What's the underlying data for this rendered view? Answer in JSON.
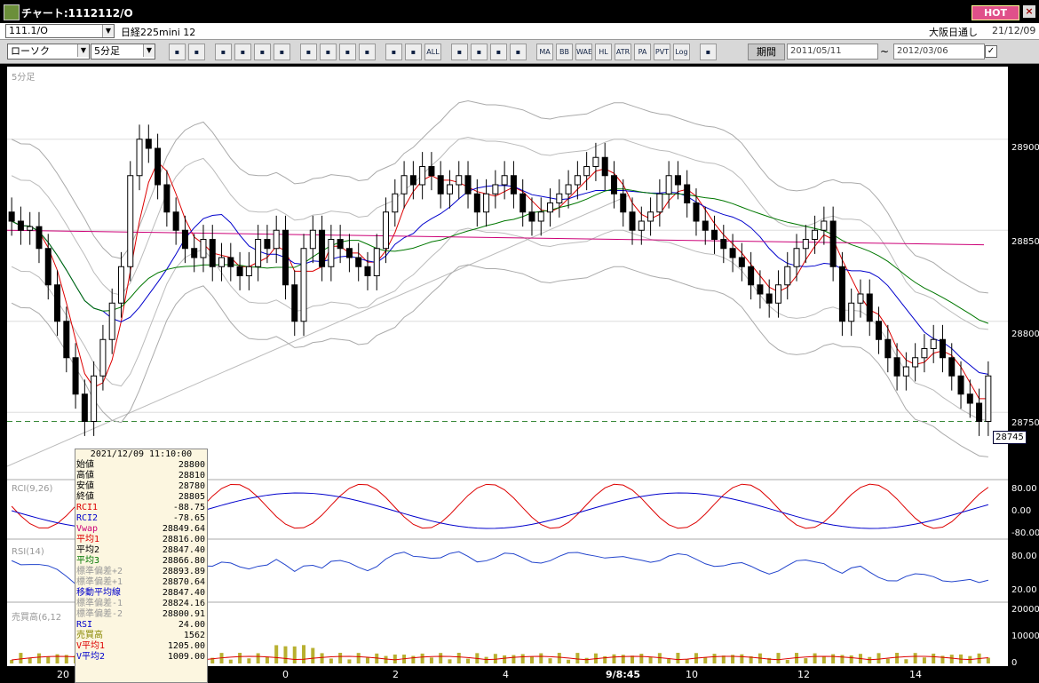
{
  "window": {
    "title": "チャート:1112112/O",
    "hot_label": "HOT",
    "close_glyph": "×"
  },
  "infobar": {
    "symbol": "111.1/O",
    "issue": "日経225mini 12",
    "market": "大阪日通し",
    "date": "21/12/09"
  },
  "toolbar": {
    "chart_type": "ローソク",
    "timeframe": "5分足",
    "period_button": "期間",
    "date_from": "2011/05/11",
    "date_to": "2012/03/06",
    "tilde": "~",
    "icons": [
      "search-icon",
      "crosshair-icon",
      "grid-icon",
      "zoom-icon",
      "indicator-icon",
      "bars-icon",
      "trend-icon",
      "pen-icon",
      "pointer-icon",
      "undo-icon",
      "compare-icon",
      "left-icon",
      "ALL",
      "settings-icon",
      "tool-icon",
      "color-icon",
      "ma-icon",
      "MA",
      "BB",
      "WAE",
      "HL",
      "ATR",
      "PA",
      "PVT",
      "Log",
      "export-icon"
    ]
  },
  "chart": {
    "timeframe_label": "5分足",
    "rci_label": "RCI(9,26)",
    "rsi_label": "RSI(14)",
    "volume_label": "売買高(6,12",
    "last_price": "28745",
    "price_axis": [
      "28900",
      "28850",
      "28800",
      "28750"
    ],
    "rci_axis": [
      "80.00",
      "0.00",
      "-80.00"
    ],
    "rsi_axis": [
      "80.00",
      "20.00"
    ],
    "vol_axis": [
      "20000",
      "10000",
      "0"
    ],
    "time_axis": [
      "20",
      "0",
      "2",
      "4",
      "9/8:45",
      "10",
      "12",
      "14"
    ]
  },
  "info_panel": {
    "datetime": "2021/12/09  11:10:00",
    "rows": [
      {
        "k": "始値",
        "v": "28800",
        "color": "#000000"
      },
      {
        "k": "高値",
        "v": "28810",
        "color": "#000000"
      },
      {
        "k": "安値",
        "v": "28780",
        "color": "#000000"
      },
      {
        "k": "終値",
        "v": "28805",
        "color": "#000000"
      },
      {
        "k": "RCI1",
        "v": "-88.75",
        "color": "#dd0000"
      },
      {
        "k": "RCI2",
        "v": "-78.65",
        "color": "#0000cc"
      },
      {
        "k": "Vwap",
        "v": "28849.64",
        "color": "#cc0077"
      },
      {
        "k": "平均1",
        "v": "28816.00",
        "color": "#dd0000"
      },
      {
        "k": "平均2",
        "v": "28847.40",
        "color": "#000000"
      },
      {
        "k": "平均3",
        "v": "28866.80",
        "color": "#007700"
      },
      {
        "k": "標準偏差+2",
        "v": "28893.89",
        "color": "#999999"
      },
      {
        "k": "標準偏差+1",
        "v": "28870.64",
        "color": "#999999"
      },
      {
        "k": "移動平均線",
        "v": "28847.40",
        "color": "#0000cc"
      },
      {
        "k": "標準偏差-1",
        "v": "28824.16",
        "color": "#999999"
      },
      {
        "k": "標準偏差-2",
        "v": "28800.91",
        "color": "#999999"
      },
      {
        "k": "RSI",
        "v": "24.00",
        "color": "#0000cc"
      },
      {
        "k": "売買高",
        "v": "1562",
        "color": "#888800"
      },
      {
        "k": "V平均1",
        "v": "1205.00",
        "color": "#dd0000"
      },
      {
        "k": "V平均2",
        "v": "1009.00",
        "color": "#0000cc"
      }
    ]
  },
  "chart_data": {
    "type": "candlestick",
    "price_range": [
      28735,
      28935
    ],
    "closes": [
      28855,
      28850,
      28852,
      28840,
      28820,
      28800,
      28780,
      28760,
      28745,
      28770,
      28790,
      28810,
      28830,
      28880,
      28900,
      28895,
      28875,
      28860,
      28850,
      28840,
      28835,
      28845,
      28830,
      28835,
      28830,
      28825,
      28830,
      28845,
      28840,
      28850,
      28820,
      28800,
      28840,
      28850,
      28830,
      28845,
      28840,
      28835,
      28830,
      28825,
      28840,
      28860,
      28870,
      28880,
      28875,
      28885,
      28880,
      28870,
      28875,
      28880,
      28870,
      28860,
      28870,
      28875,
      28880,
      28870,
      28860,
      28855,
      28860,
      28865,
      28870,
      28875,
      28880,
      28885,
      28890,
      28880,
      28870,
      28860,
      28850,
      28855,
      28860,
      28870,
      28880,
      28875,
      28865,
      28855,
      28850,
      28845,
      28840,
      28835,
      28830,
      28820,
      28815,
      28810,
      28820,
      28830,
      28840,
      28845,
      28850,
      28855,
      28830,
      28800,
      28810,
      28815,
      28800,
      28790,
      28780,
      28770,
      28775,
      28780,
      28785,
      28790,
      28780,
      28770,
      28760,
      28755,
      28745,
      28770
    ]
  }
}
